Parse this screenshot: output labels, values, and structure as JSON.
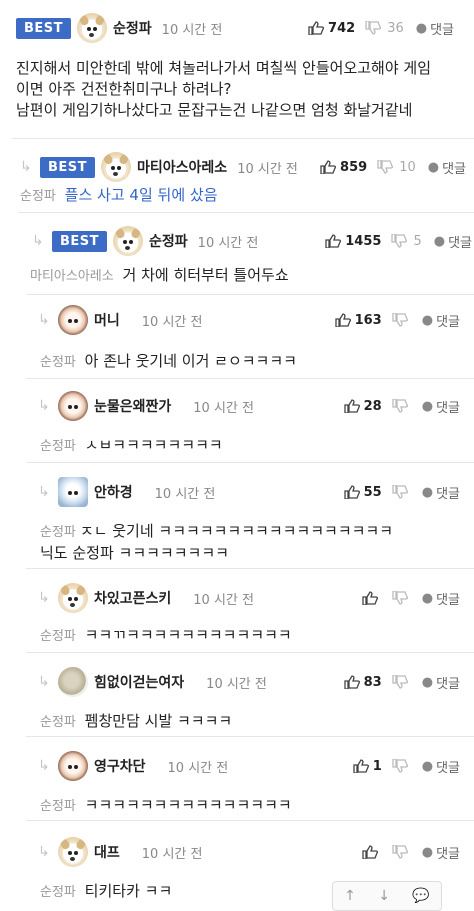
{
  "comments": [
    {
      "badge": "BEST",
      "name": "순정파",
      "time": "10 시간 전",
      "likes": "742",
      "dislikes": "36",
      "reply": "댓글",
      "lines": [
        "진지해서 미안한데 밖에 쳐놀러나가서 며칠씩 안들어오고해야 게임",
        "이면 아주 건전한취미구나 하려나?",
        "남편이 게임기하나샀다고 문잡구는건 나같으면 엄청 화날거같네"
      ]
    },
    {
      "badge": "BEST",
      "name": "마티아스아레소",
      "time": "10 시간 전",
      "likes": "859",
      "dislikes": "10",
      "reply": "댓글",
      "mention": "순정파",
      "text": "플스 사고 4일 뒤에 샀음"
    },
    {
      "badge": "BEST",
      "name": "순정파",
      "time": "10 시간 전",
      "likes": "1455",
      "dislikes": "5",
      "reply": "댓글",
      "mention": "마티아스아레소",
      "text": "거 차에 히터부터 틀어두쇼"
    },
    {
      "name": "머니",
      "time": "10 시간 전",
      "likes": "163",
      "reply": "댓글",
      "mention": "순정파",
      "text": "아 존나 웃기네 이거 ㄹㅇㅋㅋㅋㅋ"
    },
    {
      "name": "눈물은왜짠가",
      "time": "10 시간 전",
      "likes": "28",
      "reply": "댓글",
      "mention": "순정파",
      "text": "ㅅㅂㅋㅋㅋㅋㅋㅋㅋㅋ"
    },
    {
      "name": "안하경",
      "time": "10 시간 전",
      "likes": "55",
      "reply": "댓글",
      "mention": "순정파",
      "text": "ㅈㄴ 웃기네 ㅋㅋㅋㅋㅋㅋㅋㅋㅋㅋㅋㅋㅋㅋㅋㅋㅋ",
      "text2": "닉도 순정파 ㅋㅋㅋㅋㅋㅋㅋㅋ"
    },
    {
      "name": "차있고픈스키",
      "time": "10 시간 전",
      "reply": "댓글",
      "mention": "순정파",
      "text": "ㅋㅋㄲㅋㅋㅋㅋㅋㅋㅋㅋㅋㅋㅋㅋ"
    },
    {
      "name": "힘없이걷는여자",
      "time": "10 시간 전",
      "likes": "83",
      "reply": "댓글",
      "mention": "순정파",
      "text": "펨창만담 시발 ㅋㅋㅋㅋ"
    },
    {
      "name": "영구차단",
      "time": "10 시간 전",
      "likes": "1",
      "reply": "댓글",
      "mention": "순정파",
      "text": "ㅋㅋㅋㅋㅋㅋㅋㅋㅋㅋㅋㅋㅋㅋㅋ"
    },
    {
      "name": "대프",
      "time": "10 시간 전",
      "reply": "댓글",
      "mention": "순정파",
      "text": "티키타카 ㅋㅋ"
    }
  ],
  "fab": {
    "up": "↑",
    "down": "↓",
    "comment": "💬"
  },
  "colors": {
    "best_badge": "#3d6cc6",
    "mention_link": "#3366cc"
  }
}
